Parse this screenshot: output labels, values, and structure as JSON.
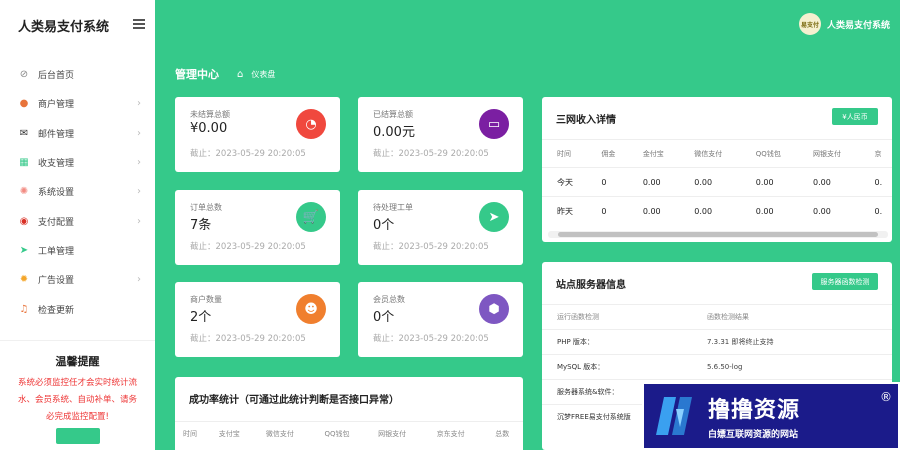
{
  "sidebar": {
    "brand": "人类易支付系统",
    "items": [
      {
        "label": "后台首页",
        "icon": "dashboard-icon",
        "color": "#888888",
        "chevron": false
      },
      {
        "label": "商户管理",
        "icon": "user-icon",
        "color": "#e8743b",
        "chevron": true
      },
      {
        "label": "邮件管理",
        "icon": "mail-icon",
        "color": "#333333",
        "chevron": true
      },
      {
        "label": "收支管理",
        "icon": "ledger-icon",
        "color": "#35c98a",
        "chevron": true
      },
      {
        "label": "系统设置",
        "icon": "gear-icon",
        "color": "#f28b82",
        "chevron": true
      },
      {
        "label": "支付配置",
        "icon": "bag-icon",
        "color": "#d93025",
        "chevron": true
      },
      {
        "label": "工单管理",
        "icon": "send-icon",
        "color": "#35c98a",
        "chevron": false
      },
      {
        "label": "广告设置",
        "icon": "sun-icon",
        "color": "#f4a62a",
        "chevron": true
      },
      {
        "label": "检查更新",
        "icon": "music-icon",
        "color": "#e8743b",
        "chevron": false
      }
    ],
    "notice": {
      "title": "温馨提醒",
      "text": "系统必须监控任才会实时统计流水、会员系统、自动补单、请务必完成监控配置!"
    }
  },
  "header": {
    "user_name": "人类易支付系统",
    "avatar_text": "易支付",
    "breadcrumb_main": "管理中心",
    "breadcrumb_sub": "仪表盘"
  },
  "stats": [
    {
      "label": "未结算总额",
      "value": "¥0.00",
      "time": "截止：2023-05-29 20:20:05",
      "icon": "pie-chart-icon",
      "color": "#f0483e"
    },
    {
      "label": "已结算总额",
      "value": "0.00元",
      "time": "截止：2023-05-29 20:20:05",
      "icon": "wallet-icon",
      "color": "#7b1fa2"
    },
    {
      "label": "订单总数",
      "value": "7条",
      "time": "截止：2023-05-29 20:20:05",
      "icon": "cart-icon",
      "color": "#35c98a"
    },
    {
      "label": "待处理工单",
      "value": "0个",
      "time": "截止：2023-05-29 20:20:05",
      "icon": "send-icon",
      "color": "#35c98a"
    },
    {
      "label": "商户数量",
      "value": "2个",
      "time": "截止：2023-05-29 20:20:05",
      "icon": "user-circle-icon",
      "color": "#f07f2e"
    },
    {
      "label": "会员总数",
      "value": "0个",
      "time": "截止：2023-05-29 20:20:05",
      "icon": "cube-icon",
      "color": "#7e57c2"
    }
  ],
  "income": {
    "title": "三网收入详情",
    "button": "¥人民币",
    "columns": [
      "时间",
      "佣金",
      "金付宝",
      "微信支付",
      "QQ钱包",
      "网银支付",
      "京"
    ],
    "rows": [
      [
        "今天",
        "0",
        "0.00",
        "0.00",
        "0.00",
        "0.00",
        "0."
      ],
      [
        "昨天",
        "0",
        "0.00",
        "0.00",
        "0.00",
        "0.00",
        "0."
      ]
    ]
  },
  "server": {
    "title": "站点服务器信息",
    "button": "服务器函数检测",
    "head": [
      "运行函数检测",
      "函数检测结果"
    ],
    "rows": [
      [
        "PHP 版本：",
        "7.3.31 即将终止支持"
      ],
      [
        "MySQL 版本：",
        "5.6.50-log"
      ],
      [
        "服务器系统&软件：",
        ""
      ],
      [
        "沉梦FREE易支付系统版",
        ""
      ]
    ]
  },
  "success": {
    "title": "成功率统计（可通过此统计判断是否接口异常）",
    "columns": [
      "时间",
      "支付宝",
      "微信支付",
      "QQ钱包",
      "网银支付",
      "京东支付",
      "总数"
    ]
  },
  "watermark": {
    "big": "撸撸资源",
    "small": "白嫖互联网资源的网站",
    "reg": "®"
  }
}
